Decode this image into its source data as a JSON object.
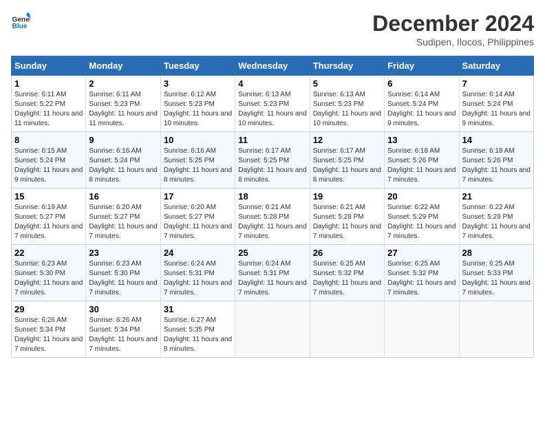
{
  "header": {
    "logo_line1": "General",
    "logo_line2": "Blue",
    "month_year": "December 2024",
    "location": "Sudipen, Ilocos, Philippines"
  },
  "weekdays": [
    "Sunday",
    "Monday",
    "Tuesday",
    "Wednesday",
    "Thursday",
    "Friday",
    "Saturday"
  ],
  "weeks": [
    [
      {
        "day": "1",
        "sunrise": "6:11 AM",
        "sunset": "5:22 PM",
        "daylight": "11 hours and 11 minutes"
      },
      {
        "day": "2",
        "sunrise": "6:11 AM",
        "sunset": "5:23 PM",
        "daylight": "11 hours and 11 minutes"
      },
      {
        "day": "3",
        "sunrise": "6:12 AM",
        "sunset": "5:23 PM",
        "daylight": "11 hours and 10 minutes"
      },
      {
        "day": "4",
        "sunrise": "6:13 AM",
        "sunset": "5:23 PM",
        "daylight": "11 hours and 10 minutes"
      },
      {
        "day": "5",
        "sunrise": "6:13 AM",
        "sunset": "5:23 PM",
        "daylight": "11 hours and 10 minutes"
      },
      {
        "day": "6",
        "sunrise": "6:14 AM",
        "sunset": "5:24 PM",
        "daylight": "11 hours and 9 minutes"
      },
      {
        "day": "7",
        "sunrise": "6:14 AM",
        "sunset": "5:24 PM",
        "daylight": "11 hours and 9 minutes"
      }
    ],
    [
      {
        "day": "8",
        "sunrise": "6:15 AM",
        "sunset": "5:24 PM",
        "daylight": "11 hours and 9 minutes"
      },
      {
        "day": "9",
        "sunrise": "6:16 AM",
        "sunset": "5:24 PM",
        "daylight": "11 hours and 8 minutes"
      },
      {
        "day": "10",
        "sunrise": "6:16 AM",
        "sunset": "5:25 PM",
        "daylight": "11 hours and 8 minutes"
      },
      {
        "day": "11",
        "sunrise": "6:17 AM",
        "sunset": "5:25 PM",
        "daylight": "11 hours and 8 minutes"
      },
      {
        "day": "12",
        "sunrise": "6:17 AM",
        "sunset": "5:25 PM",
        "daylight": "11 hours and 8 minutes"
      },
      {
        "day": "13",
        "sunrise": "6:18 AM",
        "sunset": "5:26 PM",
        "daylight": "11 hours and 7 minutes"
      },
      {
        "day": "14",
        "sunrise": "6:18 AM",
        "sunset": "5:26 PM",
        "daylight": "11 hours and 7 minutes"
      }
    ],
    [
      {
        "day": "15",
        "sunrise": "6:19 AM",
        "sunset": "5:27 PM",
        "daylight": "11 hours and 7 minutes"
      },
      {
        "day": "16",
        "sunrise": "6:20 AM",
        "sunset": "5:27 PM",
        "daylight": "11 hours and 7 minutes"
      },
      {
        "day": "17",
        "sunrise": "6:20 AM",
        "sunset": "5:27 PM",
        "daylight": "11 hours and 7 minutes"
      },
      {
        "day": "18",
        "sunrise": "6:21 AM",
        "sunset": "5:28 PM",
        "daylight": "11 hours and 7 minutes"
      },
      {
        "day": "19",
        "sunrise": "6:21 AM",
        "sunset": "5:28 PM",
        "daylight": "11 hours and 7 minutes"
      },
      {
        "day": "20",
        "sunrise": "6:22 AM",
        "sunset": "5:29 PM",
        "daylight": "11 hours and 7 minutes"
      },
      {
        "day": "21",
        "sunrise": "6:22 AM",
        "sunset": "5:29 PM",
        "daylight": "11 hours and 7 minutes"
      }
    ],
    [
      {
        "day": "22",
        "sunrise": "6:23 AM",
        "sunset": "5:30 PM",
        "daylight": "11 hours and 7 minutes"
      },
      {
        "day": "23",
        "sunrise": "6:23 AM",
        "sunset": "5:30 PM",
        "daylight": "11 hours and 7 minutes"
      },
      {
        "day": "24",
        "sunrise": "6:24 AM",
        "sunset": "5:31 PM",
        "daylight": "11 hours and 7 minutes"
      },
      {
        "day": "25",
        "sunrise": "6:24 AM",
        "sunset": "5:31 PM",
        "daylight": "11 hours and 7 minutes"
      },
      {
        "day": "26",
        "sunrise": "6:25 AM",
        "sunset": "5:32 PM",
        "daylight": "11 hours and 7 minutes"
      },
      {
        "day": "27",
        "sunrise": "6:25 AM",
        "sunset": "5:32 PM",
        "daylight": "11 hours and 7 minutes"
      },
      {
        "day": "28",
        "sunrise": "6:25 AM",
        "sunset": "5:33 PM",
        "daylight": "11 hours and 7 minutes"
      }
    ],
    [
      {
        "day": "29",
        "sunrise": "6:26 AM",
        "sunset": "5:34 PM",
        "daylight": "11 hours and 7 minutes"
      },
      {
        "day": "30",
        "sunrise": "6:26 AM",
        "sunset": "5:34 PM",
        "daylight": "11 hours and 7 minutes"
      },
      {
        "day": "31",
        "sunrise": "6:27 AM",
        "sunset": "5:35 PM",
        "daylight": "11 hours and 8 minutes"
      },
      null,
      null,
      null,
      null
    ]
  ],
  "labels": {
    "sunrise": "Sunrise:",
    "sunset": "Sunset:",
    "daylight": "Daylight:"
  }
}
